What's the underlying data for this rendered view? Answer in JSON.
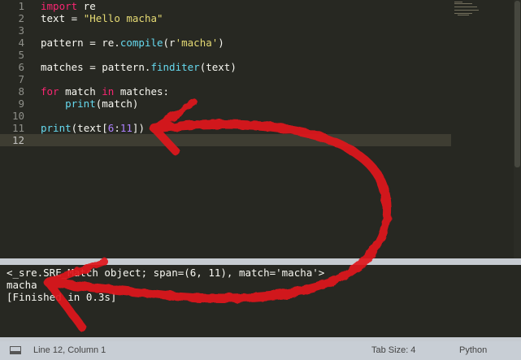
{
  "editor": {
    "lines": [
      {
        "num": "1",
        "tokens": [
          {
            "t": "import",
            "c": "kw"
          },
          {
            "t": " re",
            "c": "plain"
          }
        ]
      },
      {
        "num": "2",
        "tokens": [
          {
            "t": "text = ",
            "c": "plain"
          },
          {
            "t": "\"Hello macha\"",
            "c": "str"
          }
        ]
      },
      {
        "num": "3",
        "tokens": []
      },
      {
        "num": "4",
        "tokens": [
          {
            "t": "pattern = re.",
            "c": "plain"
          },
          {
            "t": "compile",
            "c": "fn"
          },
          {
            "t": "(r",
            "c": "plain"
          },
          {
            "t": "'macha'",
            "c": "str"
          },
          {
            "t": ")",
            "c": "plain"
          }
        ]
      },
      {
        "num": "5",
        "tokens": []
      },
      {
        "num": "6",
        "tokens": [
          {
            "t": "matches = pattern.",
            "c": "plain"
          },
          {
            "t": "finditer",
            "c": "fn"
          },
          {
            "t": "(text)",
            "c": "plain"
          }
        ]
      },
      {
        "num": "7",
        "tokens": []
      },
      {
        "num": "8",
        "tokens": [
          {
            "t": "for",
            "c": "kw"
          },
          {
            "t": " match ",
            "c": "plain"
          },
          {
            "t": "in",
            "c": "kw"
          },
          {
            "t": " matches:",
            "c": "plain"
          }
        ]
      },
      {
        "num": "9",
        "tokens": [
          {
            "t": "    ",
            "c": "plain"
          },
          {
            "t": "print",
            "c": "fn"
          },
          {
            "t": "(match)",
            "c": "plain"
          }
        ]
      },
      {
        "num": "10",
        "tokens": []
      },
      {
        "num": "11",
        "tokens": [
          {
            "t": "print",
            "c": "fn"
          },
          {
            "t": "(text[",
            "c": "plain"
          },
          {
            "t": "6",
            "c": "num"
          },
          {
            "t": ":",
            "c": "plain"
          },
          {
            "t": "11",
            "c": "num"
          },
          {
            "t": "])",
            "c": "plain"
          }
        ]
      },
      {
        "num": "12",
        "tokens": [],
        "current": true
      }
    ]
  },
  "console": {
    "lines": [
      "<_sre.SRE_Match object; span=(6, 11), match='macha'>",
      "macha",
      "[Finished in 0.3s]"
    ]
  },
  "status": {
    "position": "Line 12, Column 1",
    "tab_size": "Tab Size: 4",
    "syntax": "Python"
  },
  "colors": {
    "background": "#272822",
    "keyword": "#f92672",
    "string": "#e6db74",
    "function": "#66d9ef",
    "number": "#ae81ff",
    "text": "#f8f8f2",
    "annotation": "#e0141e"
  },
  "icons": {
    "panel_toggle": "panel-icon"
  }
}
